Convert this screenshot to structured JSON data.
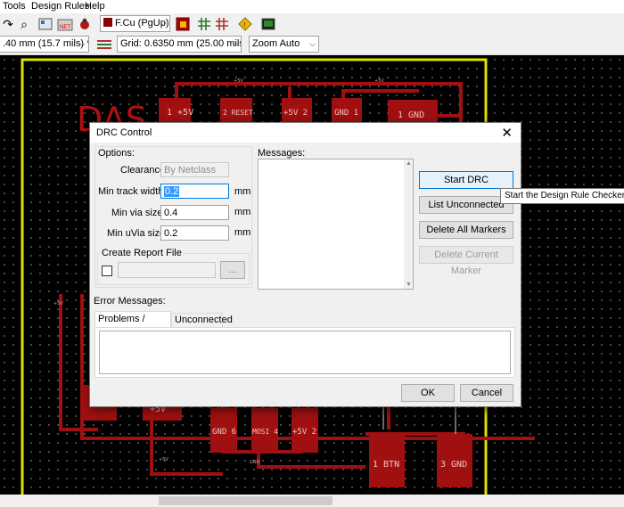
{
  "menu": {
    "tools": "Tools",
    "design_rules": "Design Rules",
    "help": "Help"
  },
  "toolbar": {
    "layer": "F.Cu (PgUp)",
    "track_width": ".40 mm (15.7 mils) *",
    "grid": "Grid: 0.6350 mm (25.00 mils)",
    "zoom": "Zoom Auto"
  },
  "pcb": {
    "silk_text": "DAS",
    "net_labels": {
      "plus5v": "+5V",
      "gnd": "GND"
    },
    "pads": [
      {
        "text": "1 +5V"
      },
      {
        "text": "2 RESET"
      },
      {
        "text": "+5V 2"
      },
      {
        "text": "GND 1"
      },
      {
        "text": "1 GND"
      },
      {
        "text": "+5V"
      },
      {
        "text": "GND 6"
      },
      {
        "text": "MOSI 4"
      },
      {
        "text": "+5V 2"
      },
      {
        "text": "1 BTN"
      },
      {
        "text": "3 GND"
      }
    ]
  },
  "dialog": {
    "title": "DRC Control",
    "close": "✕",
    "options_label": "Options:",
    "clearance_label": "Clearance",
    "clearance_value": "By Netclass",
    "min_track_label": "Min track width",
    "min_track_value": "0.2",
    "min_via_label": "Min via size",
    "min_via_value": "0.4",
    "min_uvia_label": "Min uVia size",
    "min_uvia_value": "0.2",
    "unit": "mm",
    "report_label": "Create Report File",
    "browse": "...",
    "messages_label": "Messages:",
    "buttons": {
      "start": "Start DRC",
      "list_unconnected": "List Unconnected",
      "delete_all": "Delete All Markers",
      "delete_current": "Delete Current Marker"
    },
    "error_messages_label": "Error Messages:",
    "tabs": {
      "problems": "Problems / Markers",
      "unconnected": "Unconnected"
    },
    "ok": "OK",
    "cancel": "Cancel"
  },
  "tooltip": "Start the Design Rule Checker"
}
